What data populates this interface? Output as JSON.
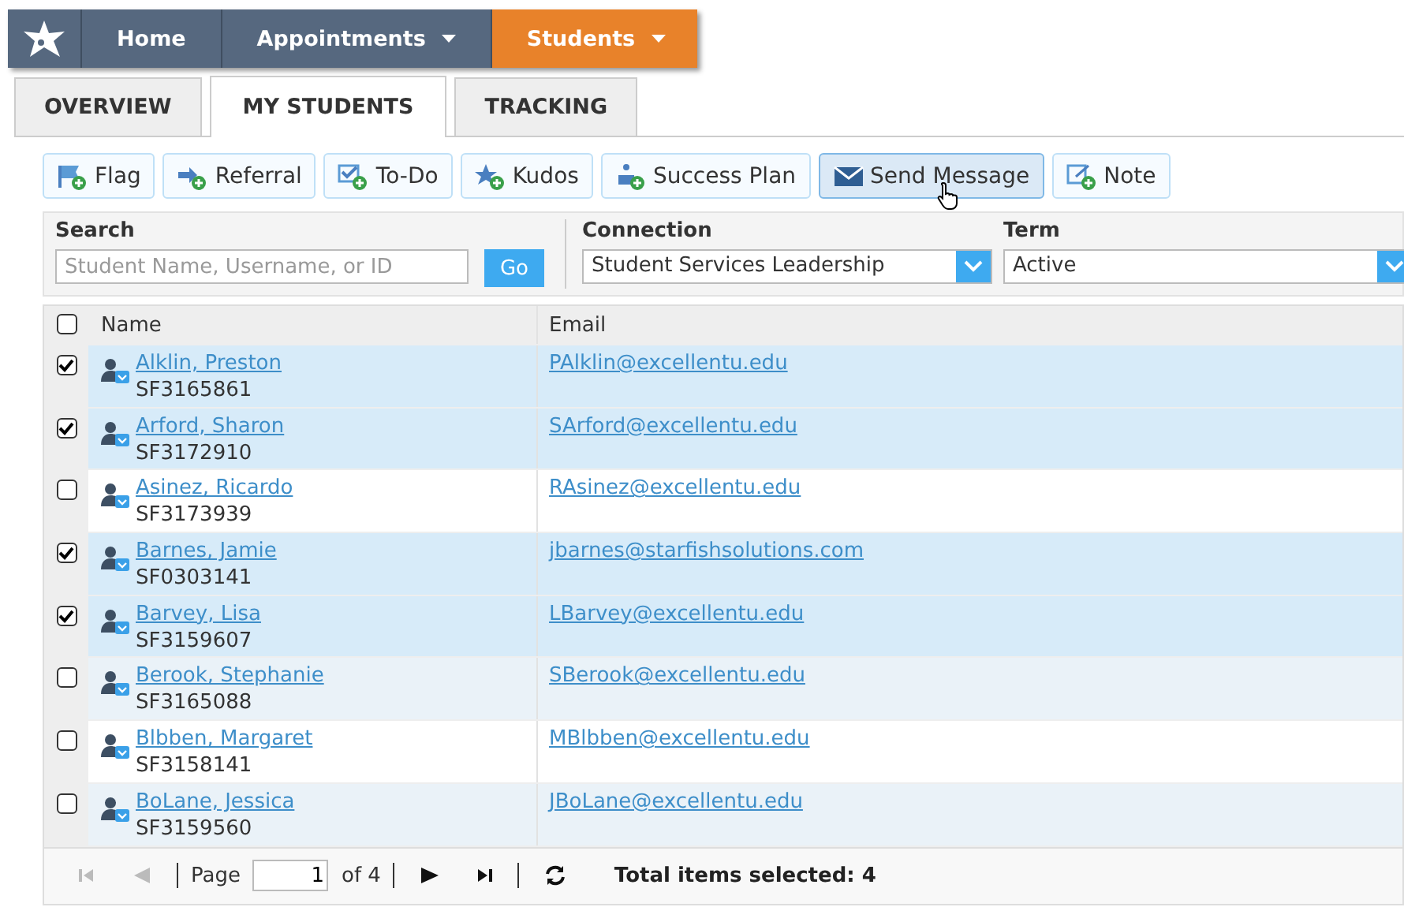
{
  "nav": {
    "items": [
      {
        "label": "Home",
        "dropdown": false,
        "selected": false
      },
      {
        "label": "Appointments",
        "dropdown": true,
        "selected": false
      },
      {
        "label": "Students",
        "dropdown": true,
        "selected": true
      }
    ]
  },
  "tabs": [
    {
      "label": "OVERVIEW",
      "selected": false
    },
    {
      "label": "MY STUDENTS",
      "selected": true
    },
    {
      "label": "TRACKING",
      "selected": false
    }
  ],
  "toolbar": [
    {
      "label": "Flag",
      "kind": "flag",
      "highlighted": false
    },
    {
      "label": "Referral",
      "kind": "referral",
      "highlighted": false
    },
    {
      "label": "To-Do",
      "kind": "todo",
      "highlighted": false
    },
    {
      "label": "Kudos",
      "kind": "kudos",
      "highlighted": false
    },
    {
      "label": "Success Plan",
      "kind": "plan",
      "highlighted": false
    },
    {
      "label": "Send Message",
      "kind": "message",
      "highlighted": true
    },
    {
      "label": "Note",
      "kind": "note",
      "highlighted": false
    }
  ],
  "filters": {
    "search": {
      "label": "Search",
      "placeholder": "Student Name, Username, or ID",
      "button": "Go"
    },
    "connection": {
      "label": "Connection",
      "value": "Student Services Leadership"
    },
    "term": {
      "label": "Term",
      "value": "Active"
    }
  },
  "table": {
    "select_all": {
      "checked": false
    },
    "columns": [
      "Name",
      "Email"
    ],
    "rows": [
      {
        "checked": true,
        "name": "Alklin, Preston",
        "id": "SF3165861",
        "email": "PAlklin@excellentu.edu"
      },
      {
        "checked": true,
        "name": "Arford, Sharon",
        "id": "SF3172910",
        "email": "SArford@excellentu.edu"
      },
      {
        "checked": false,
        "name": "Asinez, Ricardo",
        "id": "SF3173939",
        "email": "RAsinez@excellentu.edu"
      },
      {
        "checked": true,
        "name": "Barnes, Jamie",
        "id": "SF0303141",
        "email": "jbarnes@starfishsolutions.com"
      },
      {
        "checked": true,
        "name": "Barvey, Lisa",
        "id": "SF3159607",
        "email": "LBarvey@excellentu.edu"
      },
      {
        "checked": false,
        "name": "Berook, Stephanie",
        "id": "SF3165088",
        "email": "SBerook@excellentu.edu"
      },
      {
        "checked": false,
        "name": "Blbben, Margaret",
        "id": "SF3158141",
        "email": "MBlbben@excellentu.edu"
      },
      {
        "checked": false,
        "name": "BoLane, Jessica",
        "id": "SF3159560",
        "email": "JBoLane@excellentu.edu"
      }
    ]
  },
  "pager": {
    "page_label": "Page",
    "page": "1",
    "of": "of 4",
    "total": "Total items selected: 4"
  }
}
